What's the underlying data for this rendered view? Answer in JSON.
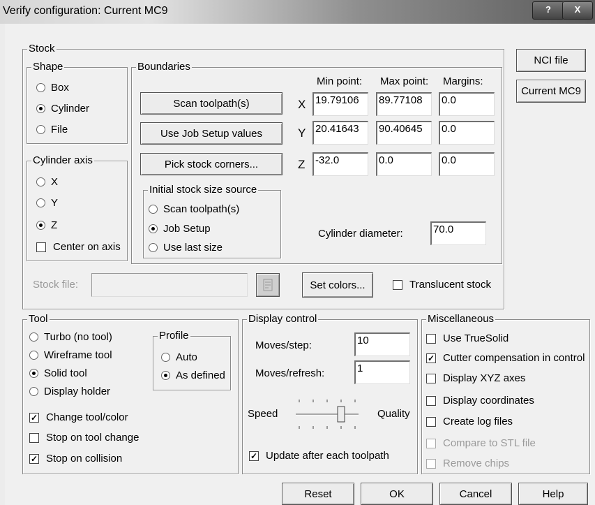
{
  "window": {
    "title": "Verify configuration: Current MC9",
    "help_glyph": "?",
    "close_glyph": "X"
  },
  "stock": {
    "group_label": "Stock",
    "shape": {
      "label": "Shape",
      "options": [
        "Box",
        "Cylinder",
        "File"
      ],
      "selected": "Cylinder"
    },
    "boundaries": {
      "label": "Boundaries",
      "scan_button": "Scan toolpath(s)",
      "job_setup_button": "Use Job Setup values",
      "pick_corners_button": "Pick stock corners...",
      "col_min": "Min point:",
      "col_max": "Max point:",
      "col_margins": "Margins:",
      "rows": [
        {
          "axis": "X",
          "min": "19.79106",
          "max": "89.77108",
          "margin": "0.0"
        },
        {
          "axis": "Y",
          "min": "20.41643",
          "max": "90.40645",
          "margin": "0.0"
        },
        {
          "axis": "Z",
          "min": "-32.0",
          "max": "0.0",
          "margin": "0.0"
        }
      ],
      "initial_source": {
        "label": "Initial stock size source",
        "options": [
          "Scan toolpath(s)",
          "Job Setup",
          "Use last size"
        ],
        "selected": "Job Setup"
      },
      "cylinder_diameter_label": "Cylinder diameter:",
      "cylinder_diameter": "70.0"
    },
    "cylinder_axis": {
      "label": "Cylinder axis",
      "options": [
        "X",
        "Y",
        "Z"
      ],
      "selected": "Z",
      "center_on_axis": "Center on axis"
    },
    "stock_file_label": "Stock file:",
    "stock_file_value": "",
    "set_colors_button": "Set colors...",
    "translucent_label": "Translucent stock"
  },
  "side_buttons": {
    "nci": "NCI file",
    "current": "Current MC9"
  },
  "tool": {
    "label": "Tool",
    "options": [
      "Turbo (no tool)",
      "Wireframe tool",
      "Solid tool",
      "Display holder"
    ],
    "selected": "Solid tool",
    "profile": {
      "label": "Profile",
      "options": [
        "Auto",
        "As defined"
      ],
      "selected": "As defined"
    },
    "checks": [
      {
        "label": "Change tool/color",
        "checked": true
      },
      {
        "label": "Stop on tool change",
        "checked": false
      },
      {
        "label": "Stop on collision",
        "checked": true
      }
    ]
  },
  "display_control": {
    "label": "Display control",
    "moves_step_label": "Moves/step:",
    "moves_step": "10",
    "moves_refresh_label": "Moves/refresh:",
    "moves_refresh": "1",
    "speed_label": "Speed",
    "quality_label": "Quality",
    "slider_level": 0.75,
    "update_label": "Update after each toolpath",
    "update_checked": true
  },
  "misc": {
    "label": "Miscellaneous",
    "checks": [
      {
        "label": "Use TrueSolid",
        "checked": false,
        "enabled": true
      },
      {
        "label": "Cutter compensation in control",
        "checked": true,
        "enabled": true
      },
      {
        "label": "Display XYZ axes",
        "checked": false,
        "enabled": true
      },
      {
        "label": "Display coordinates",
        "checked": false,
        "enabled": true
      },
      {
        "label": "Create log files",
        "checked": false,
        "enabled": true
      },
      {
        "label": "Compare to STL file",
        "checked": false,
        "enabled": false
      },
      {
        "label": "Remove chips",
        "checked": false,
        "enabled": false
      }
    ]
  },
  "footer": {
    "reset": "Reset",
    "ok": "OK",
    "cancel": "Cancel",
    "help": "Help"
  }
}
